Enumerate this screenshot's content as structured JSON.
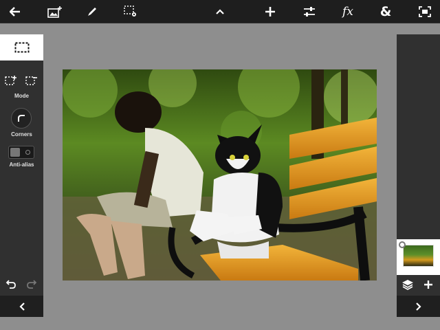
{
  "toolbar": {
    "back_icon": "back-arrow-icon",
    "add_image_icon": "add-image-icon",
    "brush_icon": "brush-icon",
    "selection_settings_icon": "selection-settings-icon",
    "collapse_icon": "chevron-up-icon",
    "transform_icon": "move-cross-icon",
    "adjustments_icon": "sliders-icon",
    "fx_label": "fx",
    "blend_label": "&",
    "fit_icon": "fit-screen-icon"
  },
  "tool_panel": {
    "active_tool_icon": "rect-marquee-icon",
    "mode_label": "Mode",
    "corners_label": "Corners",
    "antialias_label": "Anti-alias",
    "antialias_on": false
  },
  "layers_panel": {
    "layer_count": 1
  },
  "colors": {
    "toolbar_bg": "#1e1e1e",
    "panel_bg": "#303030",
    "workspace_bg": "#8e8e8e",
    "active_tab_bg": "#ffffff",
    "bench_slats": "#e09a22"
  }
}
